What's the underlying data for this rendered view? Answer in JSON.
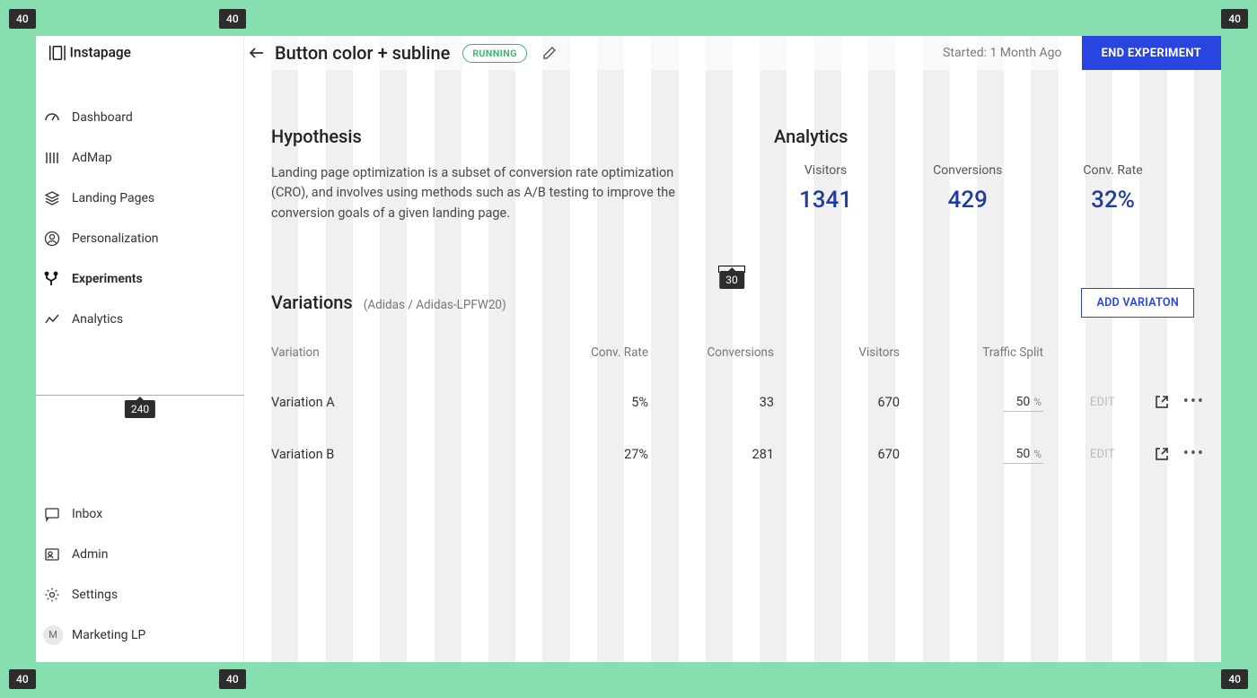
{
  "guides": {
    "margin": "40",
    "sidebar_width": "240",
    "col_gap": "30"
  },
  "brand": "Instapage",
  "sidebar": {
    "items": [
      {
        "label": "Dashboard",
        "icon": "gauge-icon"
      },
      {
        "label": "AdMap",
        "icon": "sliders-icon"
      },
      {
        "label": "Landing Pages",
        "icon": "layers-icon"
      },
      {
        "label": "Personalization",
        "icon": "user-circle-icon"
      },
      {
        "label": "Experiments",
        "icon": "branch-icon",
        "active": true
      },
      {
        "label": "Analytics",
        "icon": "trend-icon"
      }
    ],
    "bottom": [
      {
        "label": "Inbox",
        "icon": "chat-icon"
      },
      {
        "label": "Admin",
        "icon": "id-icon"
      },
      {
        "label": "Settings",
        "icon": "gear-icon"
      },
      {
        "label": "Marketing LP",
        "icon": "avatar",
        "avatar_initial": "M"
      }
    ]
  },
  "header": {
    "title": "Button color + subline",
    "status": "RUNNING",
    "started": "Started: 1 Month Ago",
    "end_button": "END EXPERIMENT"
  },
  "hypothesis": {
    "heading": "Hypothesis",
    "body": "Landing page optimization is a subset of conversion rate optimization (CRO), and involves using methods such as A/B testing to improve the conversion goals of a given landing page."
  },
  "analytics": {
    "heading": "Analytics",
    "stats": [
      {
        "label": "Visitors",
        "value": "1341"
      },
      {
        "label": "Conversions",
        "value": "429"
      },
      {
        "label": "Conv. Rate",
        "value": "32%"
      }
    ]
  },
  "variations": {
    "heading": "Variations",
    "subhead": "(Adidas / Adidas-LPFW20)",
    "add_button": "ADD VARIATON",
    "columns": {
      "variation": "Variation",
      "conv_rate": "Conv. Rate",
      "conversions": "Conversions",
      "visitors": "Visitors",
      "traffic_split": "Traffic Split"
    },
    "rows": [
      {
        "name": "Variation A",
        "conv_rate": "5%",
        "conversions": "33",
        "visitors": "670",
        "split": "50",
        "edit": "EDIT"
      },
      {
        "name": "Variation B",
        "conv_rate": "27%",
        "conversions": "281",
        "visitors": "670",
        "split": "50",
        "edit": "EDIT"
      }
    ],
    "percent_sign": "%"
  }
}
